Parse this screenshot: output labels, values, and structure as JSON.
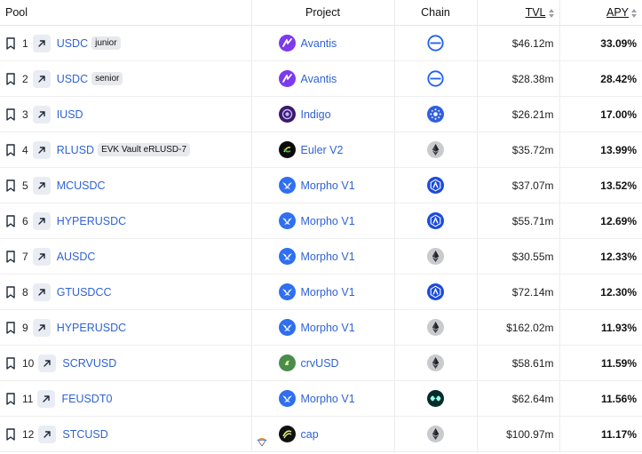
{
  "headers": {
    "pool": "Pool",
    "project": "Project",
    "chain": "Chain",
    "tvl": "TVL",
    "apy": "APY"
  },
  "rows": [
    {
      "rank": "1",
      "symbol": "USDC",
      "tag": "junior",
      "project": "Avantis",
      "project_icon": "avantis-logo",
      "chain_icon": "base-chain-icon",
      "tvl": "$46.12m",
      "apy": "33.09%"
    },
    {
      "rank": "2",
      "symbol": "USDC",
      "tag": "senior",
      "project": "Avantis",
      "project_icon": "avantis-logo",
      "chain_icon": "base-chain-icon",
      "tvl": "$28.38m",
      "apy": "28.42%"
    },
    {
      "rank": "3",
      "symbol": "IUSD",
      "tag": "",
      "project": "Indigo",
      "project_icon": "indigo-logo",
      "chain_icon": "cardano-chain-icon",
      "tvl": "$26.21m",
      "apy": "17.00%"
    },
    {
      "rank": "4",
      "symbol": "RLUSD",
      "tag": "EVK Vault eRLUSD-7",
      "project": "Euler V2",
      "project_icon": "euler-logo",
      "chain_icon": "ethereum-chain-icon",
      "tvl": "$35.72m",
      "apy": "13.99%"
    },
    {
      "rank": "5",
      "symbol": "MCUSDC",
      "tag": "",
      "project": "Morpho V1",
      "project_icon": "morpho-logo",
      "chain_icon": "arbitrum-chain-icon",
      "tvl": "$37.07m",
      "apy": "13.52%"
    },
    {
      "rank": "6",
      "symbol": "HYPERUSDC",
      "tag": "",
      "project": "Morpho V1",
      "project_icon": "morpho-logo",
      "chain_icon": "arbitrum-chain-icon",
      "tvl": "$55.71m",
      "apy": "12.69%"
    },
    {
      "rank": "7",
      "symbol": "AUSDC",
      "tag": "",
      "project": "Morpho V1",
      "project_icon": "morpho-logo",
      "chain_icon": "ethereum-chain-icon",
      "tvl": "$30.55m",
      "apy": "12.33%"
    },
    {
      "rank": "8",
      "symbol": "GTUSDCC",
      "tag": "",
      "project": "Morpho V1",
      "project_icon": "morpho-logo",
      "chain_icon": "arbitrum-chain-icon",
      "tvl": "$72.14m",
      "apy": "12.30%"
    },
    {
      "rank": "9",
      "symbol": "HYPERUSDC",
      "tag": "",
      "project": "Morpho V1",
      "project_icon": "morpho-logo",
      "chain_icon": "ethereum-chain-icon",
      "tvl": "$162.02m",
      "apy": "11.93%"
    },
    {
      "rank": "10",
      "symbol": "SCRVUSD",
      "tag": "",
      "project": "crvUSD",
      "project_icon": "crvusd-logo",
      "chain_icon": "ethereum-chain-icon",
      "tvl": "$58.61m",
      "apy": "11.59%"
    },
    {
      "rank": "11",
      "symbol": "FEUSDT0",
      "tag": "",
      "project": "Morpho V1",
      "project_icon": "morpho-logo",
      "chain_icon": "hyperliquid-chain-icon",
      "tvl": "$62.64m",
      "apy": "11.56%"
    },
    {
      "rank": "12",
      "symbol": "STCUSD",
      "tag": "",
      "project": "cap",
      "project_icon": "cap-logo",
      "chain_icon": "ethereum-chain-icon",
      "tvl": "$100.97m",
      "apy": "11.17%"
    }
  ]
}
